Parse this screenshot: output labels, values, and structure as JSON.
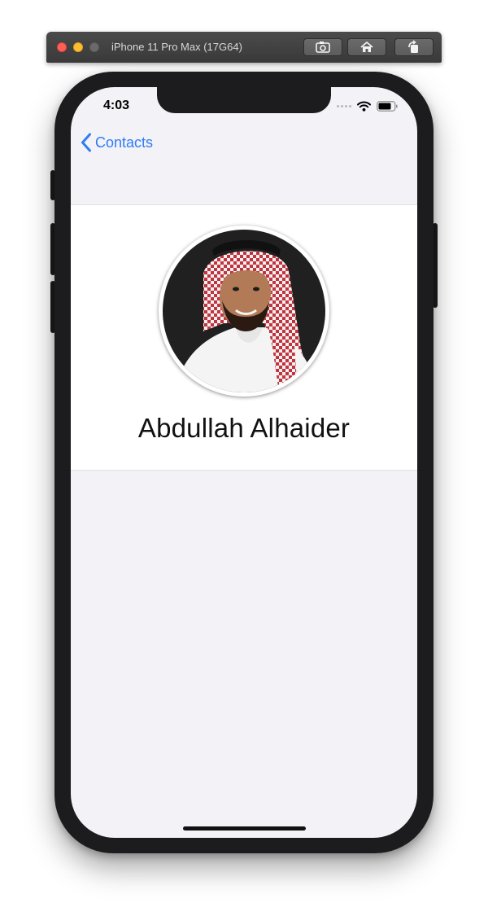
{
  "window": {
    "title": "iPhone 11 Pro Max (17G64)",
    "buttons": [
      "screenshot-icon",
      "home-icon",
      "rotate-icon"
    ]
  },
  "status_bar": {
    "time": "4:03",
    "icons": [
      "signal-icon",
      "wifi-icon",
      "battery-icon"
    ]
  },
  "nav": {
    "back_label": "Contacts",
    "back_icon": "chevron-left-icon"
  },
  "profile": {
    "name": "Abdullah Alhaider",
    "avatar": "profile-photo"
  },
  "colors": {
    "accent": "#2f7cf6",
    "background": "#f2f2f7",
    "card": "#ffffff",
    "device": "#1c1c1e"
  }
}
